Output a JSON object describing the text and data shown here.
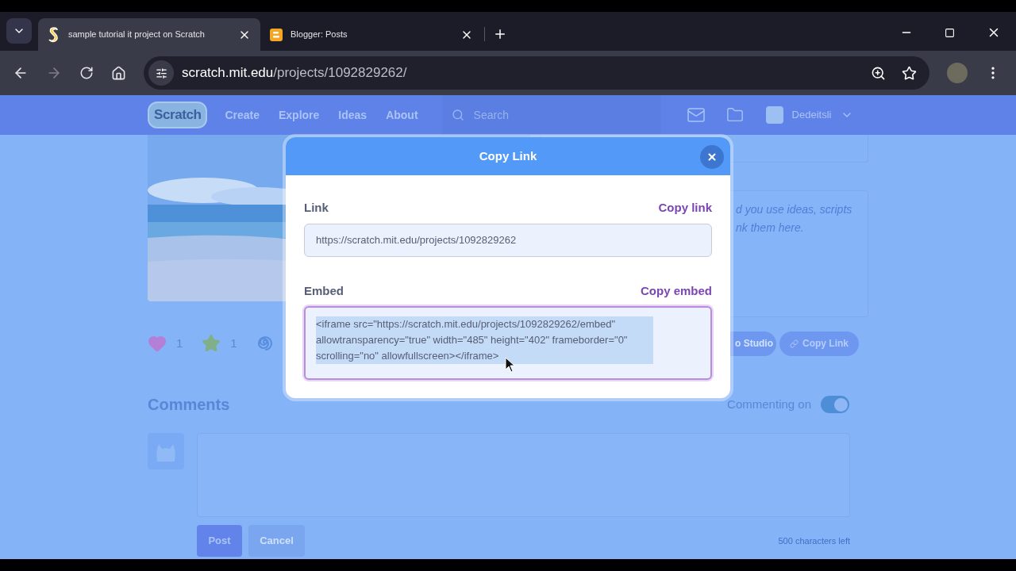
{
  "browser": {
    "tabs": [
      {
        "title": "sample tutorial it project on Scratch",
        "kind": "scratch",
        "selected": true
      },
      {
        "title": "Blogger: Posts",
        "kind": "blogger",
        "selected": false
      }
    ],
    "address": {
      "host": "scratch.mit.edu",
      "path": "/projects/1092829262/"
    }
  },
  "navbar": {
    "logo": "Scratch",
    "links": [
      "Create",
      "Explore",
      "Ideas",
      "About"
    ],
    "search": {
      "placeholder": "Search"
    },
    "username": "Dedeitsli"
  },
  "project": {
    "picture": {
      "kind": "picture"
    },
    "notes": [
      "d you use ideas, scripts",
      "nk them here."
    ],
    "stats": [
      {
        "kind": "love",
        "count": "1"
      },
      {
        "kind": "favorite",
        "count": "1"
      },
      {
        "kind": "remix"
      }
    ],
    "buttons": [
      {
        "kind": "studio",
        "label": "o Studio"
      },
      {
        "kind": "copy",
        "label": "Copy Link"
      }
    ]
  },
  "comments": {
    "title": "Comments",
    "toggle": {
      "label": "Commenting on",
      "on": true
    },
    "post": "Post",
    "cancel": "Cancel",
    "remaining": "500 characters left"
  },
  "dialog": {
    "title": "Copy Link",
    "fields": [
      {
        "label": "Link",
        "action": "Copy link",
        "value": "https://scratch.mit.edu/projects/1092829262",
        "focused": false,
        "highlighted": false
      },
      {
        "label": "Embed",
        "action": "Copy embed",
        "value": "<iframe src=\"https://scratch.mit.edu/projects/1092829262/embed\" allowtransparency=\"true\" width=\"485\" height=\"402\" frameborder=\"0\" scrolling=\"no\" allowfullscreen></iframe>",
        "focused": true,
        "highlighted": true
      }
    ]
  }
}
